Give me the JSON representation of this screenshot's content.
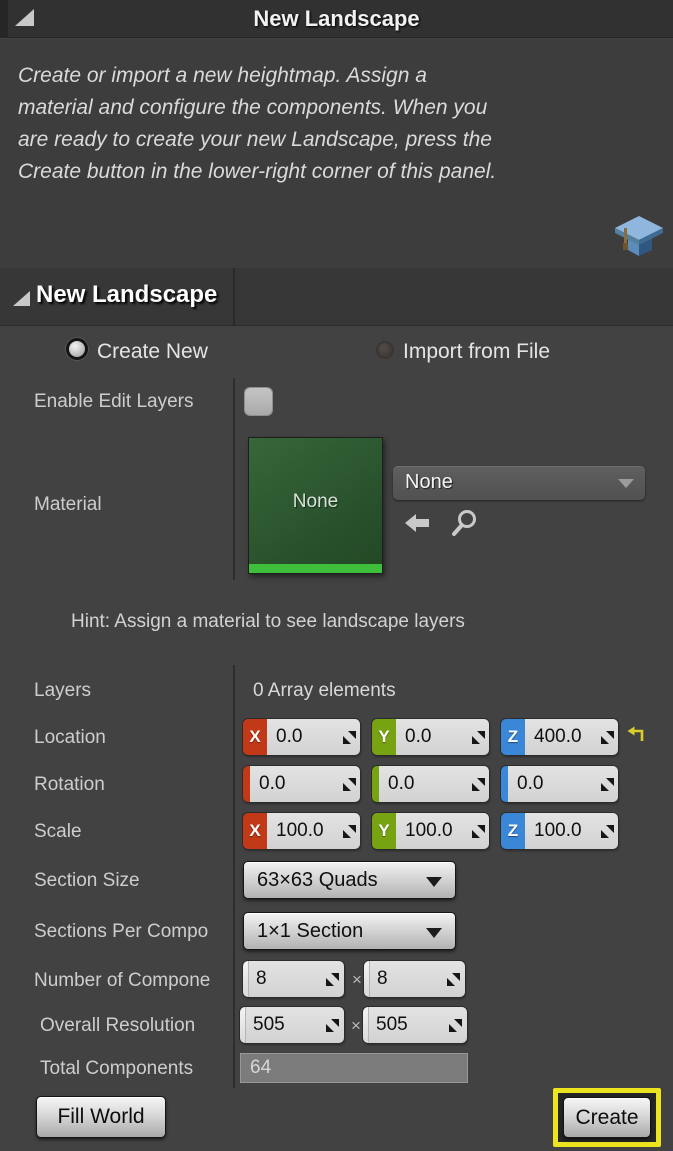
{
  "window": {
    "title": "New Landscape"
  },
  "description": {
    "lines": [
      "Create or import a new heightmap.  Assign a",
      "material and configure the components.  When you",
      "are ready to create your new Landscape, press the",
      "Create button in the lower-right corner of this panel."
    ]
  },
  "section": {
    "title": "New Landscape"
  },
  "mode": {
    "create_new_label": "Create New",
    "import_label": "Import from File",
    "selected": "Create New"
  },
  "axis_labels": {
    "x": "X",
    "y": "Y",
    "z": "Z"
  },
  "rows": {
    "enable_edit_layers": {
      "label": "Enable Edit Layers",
      "checked": false
    },
    "material": {
      "label": "Material",
      "thumbnail_text": "None",
      "selected_asset": "None"
    },
    "hint": "Hint: Assign a material to see landscape layers",
    "layers": {
      "label": "Layers",
      "value": "0 Array elements"
    },
    "location": {
      "label": "Location",
      "x": "0.0",
      "y": "0.0",
      "z": "400.0"
    },
    "rotation": {
      "label": "Rotation",
      "x": "0.0",
      "y": "0.0",
      "z": "0.0"
    },
    "scale": {
      "label": "Scale",
      "x": "100.0",
      "y": "100.0",
      "z": "100.0"
    },
    "section_size": {
      "label": "Section Size",
      "value": "63×63 Quads"
    },
    "sections_per_component": {
      "label": "Sections Per Compo",
      "value": "1×1 Section"
    },
    "number_of_components": {
      "label": "Number of Compone",
      "x": "8",
      "y": "8",
      "separator": "×"
    },
    "overall_resolution": {
      "label": "Overall Resolution",
      "x": "505",
      "y": "505",
      "separator": "×"
    },
    "total_components": {
      "label": "Total Components",
      "value": "64"
    }
  },
  "buttons": {
    "fill_world": "Fill World",
    "create": "Create"
  },
  "icons": {
    "header_collapse": "triangle-collapse-icon",
    "tutorial": "graduation-cap-icon",
    "use_selected_asset": "arrow-left-icon",
    "browse_asset": "magnifier-icon",
    "reset_to_default": "reset-arrow-icon",
    "value_drag": "diagonal-drag-icon"
  },
  "colors": {
    "axis_x": "#c13917",
    "axis_y": "#77a313",
    "axis_z": "#3a87d8",
    "focus_outline": "#ece41f",
    "thumbnail_stripe": "#3fbe3c",
    "reset_icon": "#d9cf2a"
  }
}
